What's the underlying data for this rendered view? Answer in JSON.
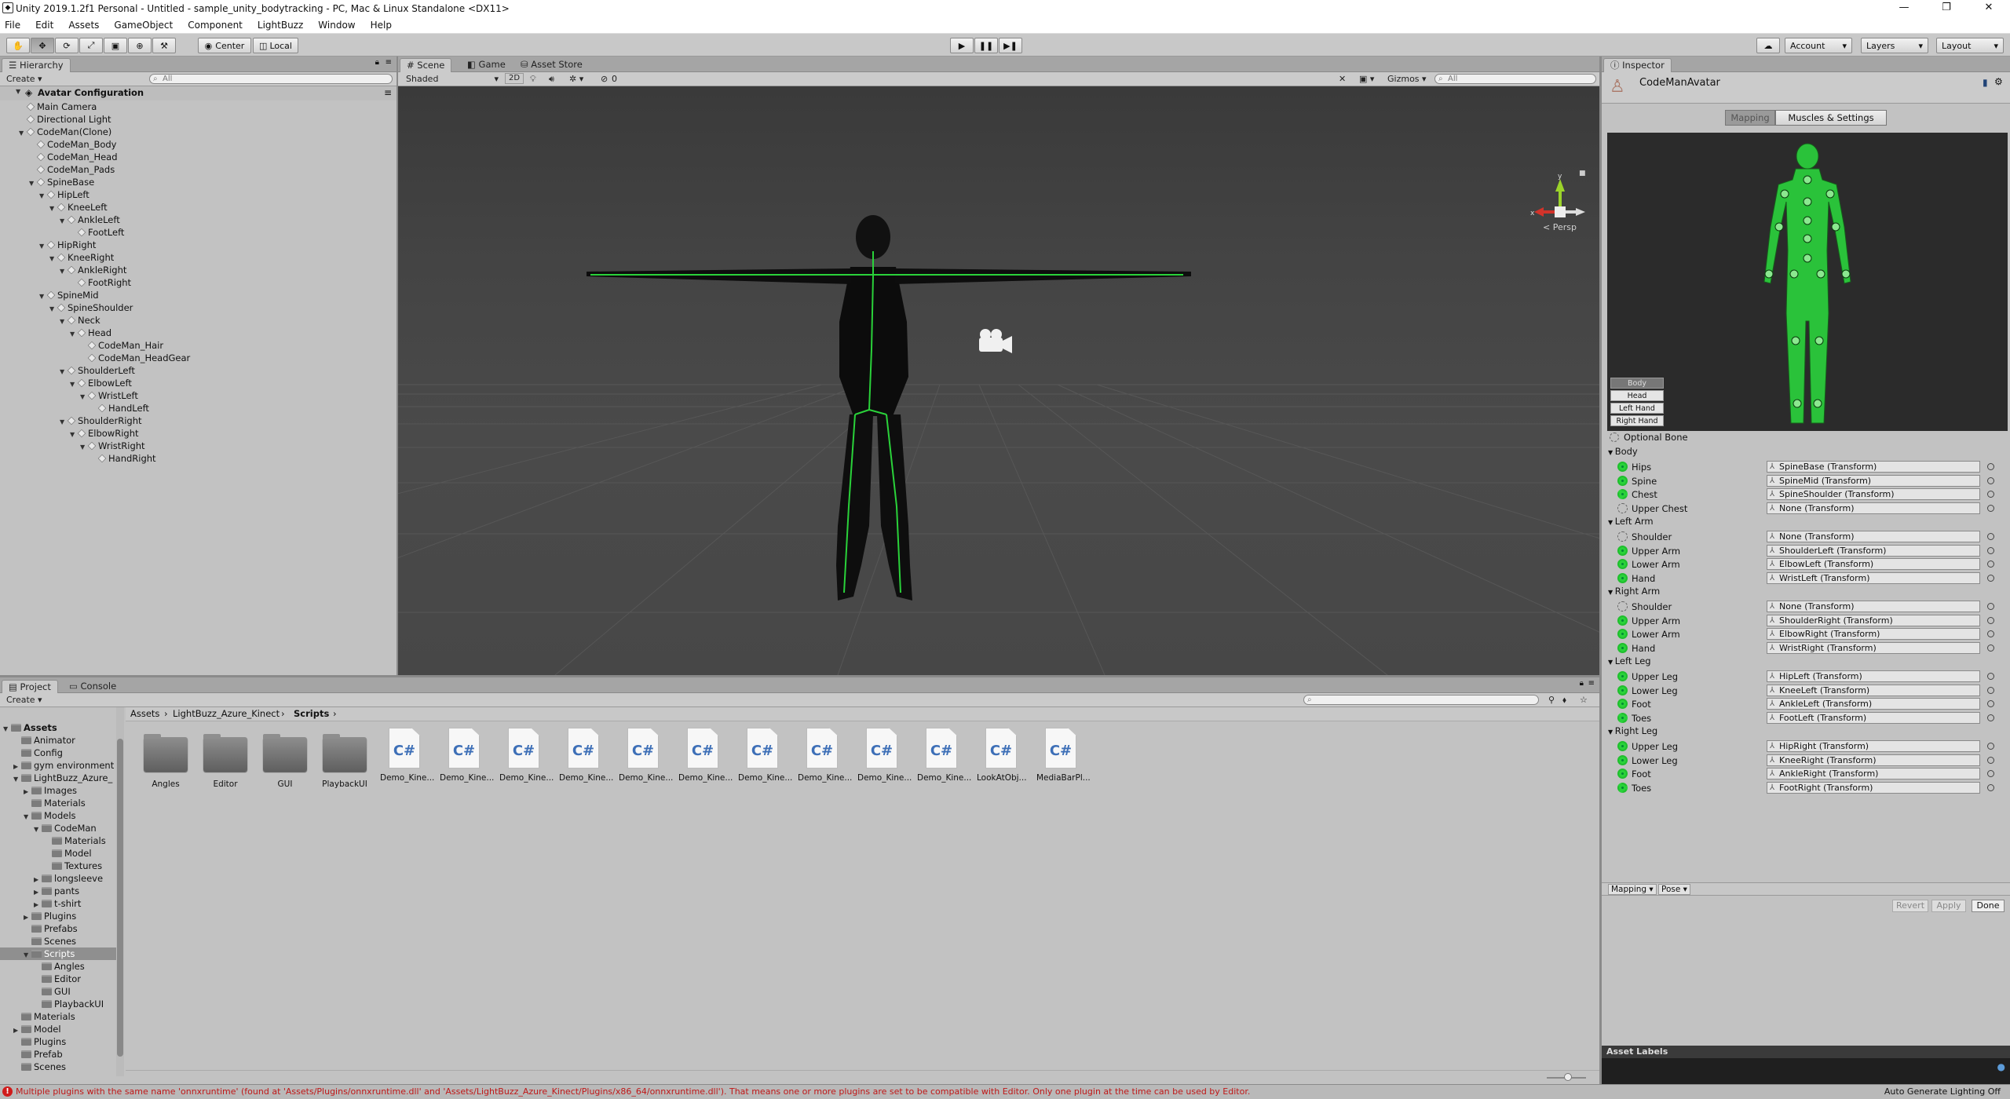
{
  "window": {
    "title": "Unity 2019.1.2f1 Personal - Untitled - sample_unity_bodytracking - PC, Mac & Linux Standalone <DX11>"
  },
  "menu": [
    "File",
    "Edit",
    "Assets",
    "GameObject",
    "Component",
    "LightBuzz",
    "Window",
    "Help"
  ],
  "toolbar": {
    "pivot": "Center",
    "space": "Local",
    "account": "Account",
    "layers": "Layers",
    "layout": "Layout"
  },
  "hierarchy": {
    "tab": "Hierarchy",
    "create": "Create",
    "search_placeholder": "All",
    "root": "Avatar Configuration",
    "items": [
      {
        "label": "Main Camera",
        "depth": 1,
        "arrow": ""
      },
      {
        "label": "Directional Light",
        "depth": 1,
        "arrow": ""
      },
      {
        "label": "CodeMan(Clone)",
        "depth": 1,
        "arrow": "▼"
      },
      {
        "label": "CodeMan_Body",
        "depth": 2,
        "arrow": ""
      },
      {
        "label": "CodeMan_Head",
        "depth": 2,
        "arrow": ""
      },
      {
        "label": "CodeMan_Pads",
        "depth": 2,
        "arrow": ""
      },
      {
        "label": "SpineBase",
        "depth": 2,
        "arrow": "▼"
      },
      {
        "label": "HipLeft",
        "depth": 3,
        "arrow": "▼"
      },
      {
        "label": "KneeLeft",
        "depth": 4,
        "arrow": "▼"
      },
      {
        "label": "AnkleLeft",
        "depth": 5,
        "arrow": "▼"
      },
      {
        "label": "FootLeft",
        "depth": 6,
        "arrow": ""
      },
      {
        "label": "HipRight",
        "depth": 3,
        "arrow": "▼"
      },
      {
        "label": "KneeRight",
        "depth": 4,
        "arrow": "▼"
      },
      {
        "label": "AnkleRight",
        "depth": 5,
        "arrow": "▼"
      },
      {
        "label": "FootRight",
        "depth": 6,
        "arrow": ""
      },
      {
        "label": "SpineMid",
        "depth": 3,
        "arrow": "▼"
      },
      {
        "label": "SpineShoulder",
        "depth": 4,
        "arrow": "▼"
      },
      {
        "label": "Neck",
        "depth": 5,
        "arrow": "▼"
      },
      {
        "label": "Head",
        "depth": 6,
        "arrow": "▼"
      },
      {
        "label": "CodeMan_Hair",
        "depth": 7,
        "arrow": ""
      },
      {
        "label": "CodeMan_HeadGear",
        "depth": 7,
        "arrow": ""
      },
      {
        "label": "ShoulderLeft",
        "depth": 5,
        "arrow": "▼"
      },
      {
        "label": "ElbowLeft",
        "depth": 6,
        "arrow": "▼"
      },
      {
        "label": "WristLeft",
        "depth": 7,
        "arrow": "▼"
      },
      {
        "label": "HandLeft",
        "depth": 8,
        "arrow": ""
      },
      {
        "label": "ShoulderRight",
        "depth": 5,
        "arrow": "▼"
      },
      {
        "label": "ElbowRight",
        "depth": 6,
        "arrow": "▼"
      },
      {
        "label": "WristRight",
        "depth": 7,
        "arrow": "▼"
      },
      {
        "label": "HandRight",
        "depth": 8,
        "arrow": ""
      }
    ]
  },
  "scene": {
    "tabs": [
      "Scene",
      "Game",
      "Asset Store"
    ],
    "shading": "Shaded",
    "mode2d": "2D",
    "fx_count": "0",
    "gizmos": "Gizmos",
    "search_placeholder": "All",
    "persp": "< Persp"
  },
  "project": {
    "tabs": [
      "Project",
      "Console"
    ],
    "create": "Create",
    "breadcrumb": [
      "Assets",
      "LightBuzz_Azure_Kinect",
      "Scripts"
    ],
    "tree": [
      {
        "label": "Assets",
        "depth": 0,
        "arrow": "▼",
        "bold": true
      },
      {
        "label": "Animator",
        "depth": 1,
        "arrow": ""
      },
      {
        "label": "Config",
        "depth": 1,
        "arrow": ""
      },
      {
        "label": "gym environment",
        "depth": 1,
        "arrow": "▶"
      },
      {
        "label": "LightBuzz_Azure_",
        "depth": 1,
        "arrow": "▼"
      },
      {
        "label": "Images",
        "depth": 2,
        "arrow": "▶"
      },
      {
        "label": "Materials",
        "depth": 2,
        "arrow": ""
      },
      {
        "label": "Models",
        "depth": 2,
        "arrow": "▼"
      },
      {
        "label": "CodeMan",
        "depth": 3,
        "arrow": "▼"
      },
      {
        "label": "Materials",
        "depth": 4,
        "arrow": ""
      },
      {
        "label": "Model",
        "depth": 4,
        "arrow": ""
      },
      {
        "label": "Textures",
        "depth": 4,
        "arrow": ""
      },
      {
        "label": "longsleeve",
        "depth": 3,
        "arrow": "▶"
      },
      {
        "label": "pants",
        "depth": 3,
        "arrow": "▶"
      },
      {
        "label": "t-shirt",
        "depth": 3,
        "arrow": "▶"
      },
      {
        "label": "Plugins",
        "depth": 2,
        "arrow": "▶"
      },
      {
        "label": "Prefabs",
        "depth": 2,
        "arrow": ""
      },
      {
        "label": "Scenes",
        "depth": 2,
        "arrow": ""
      },
      {
        "label": "Scripts",
        "depth": 2,
        "arrow": "▼",
        "selected": true
      },
      {
        "label": "Angles",
        "depth": 3,
        "arrow": ""
      },
      {
        "label": "Editor",
        "depth": 3,
        "arrow": ""
      },
      {
        "label": "GUI",
        "depth": 3,
        "arrow": ""
      },
      {
        "label": "PlaybackUI",
        "depth": 3,
        "arrow": ""
      },
      {
        "label": "Materials",
        "depth": 1,
        "arrow": ""
      },
      {
        "label": "Model",
        "depth": 1,
        "arrow": "▶"
      },
      {
        "label": "Plugins",
        "depth": 1,
        "arrow": ""
      },
      {
        "label": "Prefab",
        "depth": 1,
        "arrow": ""
      },
      {
        "label": "Scenes",
        "depth": 1,
        "arrow": ""
      }
    ],
    "assets": [
      {
        "label": "Angles",
        "kind": "folder"
      },
      {
        "label": "Editor",
        "kind": "folder"
      },
      {
        "label": "GUI",
        "kind": "folder"
      },
      {
        "label": "PlaybackUI",
        "kind": "folder"
      },
      {
        "label": "Demo_Kine...",
        "kind": "cs"
      },
      {
        "label": "Demo_Kine...",
        "kind": "cs"
      },
      {
        "label": "Demo_Kine...",
        "kind": "cs"
      },
      {
        "label": "Demo_Kine...",
        "kind": "cs"
      },
      {
        "label": "Demo_Kine...",
        "kind": "cs"
      },
      {
        "label": "Demo_Kine...",
        "kind": "cs"
      },
      {
        "label": "Demo_Kine...",
        "kind": "cs"
      },
      {
        "label": "Demo_Kine...",
        "kind": "cs"
      },
      {
        "label": "Demo_Kine...",
        "kind": "cs"
      },
      {
        "label": "Demo_Kine...",
        "kind": "cs"
      },
      {
        "label": "LookAtObj...",
        "kind": "cs"
      },
      {
        "label": "MediaBarPl...",
        "kind": "cs"
      }
    ],
    "cs_glyph": "C#"
  },
  "inspector": {
    "tab": "Inspector",
    "object_name": "CodeManAvatar",
    "mode_tabs": [
      "Mapping",
      "Muscles & Settings"
    ],
    "body_parts": [
      "Body",
      "Head",
      "Left Hand",
      "Right Hand"
    ],
    "optional_bone": "Optional Bone",
    "groups": [
      {
        "name": "Body",
        "bones": [
          {
            "label": "Hips",
            "value": "SpineBase (Transform)",
            "optional": false
          },
          {
            "label": "Spine",
            "value": "SpineMid (Transform)",
            "optional": false
          },
          {
            "label": "Chest",
            "value": "SpineShoulder (Transform)",
            "optional": true
          },
          {
            "label": "Upper Chest",
            "value": "None (Transform)",
            "optional": true
          }
        ]
      },
      {
        "name": "Left Arm",
        "bones": [
          {
            "label": "Shoulder",
            "value": "None (Transform)",
            "optional": true
          },
          {
            "label": "Upper Arm",
            "value": "ShoulderLeft (Transform)",
            "optional": false
          },
          {
            "label": "Lower Arm",
            "value": "ElbowLeft (Transform)",
            "optional": false
          },
          {
            "label": "Hand",
            "value": "WristLeft (Transform)",
            "optional": false
          }
        ]
      },
      {
        "name": "Right Arm",
        "bones": [
          {
            "label": "Shoulder",
            "value": "None (Transform)",
            "optional": true
          },
          {
            "label": "Upper Arm",
            "value": "ShoulderRight (Transform)",
            "optional": false
          },
          {
            "label": "Lower Arm",
            "value": "ElbowRight (Transform)",
            "optional": false
          },
          {
            "label": "Hand",
            "value": "WristRight (Transform)",
            "optional": false
          }
        ]
      },
      {
        "name": "Left Leg",
        "bones": [
          {
            "label": "Upper Leg",
            "value": "HipLeft (Transform)",
            "optional": false
          },
          {
            "label": "Lower Leg",
            "value": "KneeLeft (Transform)",
            "optional": false
          },
          {
            "label": "Foot",
            "value": "AnkleLeft (Transform)",
            "optional": false
          },
          {
            "label": "Toes",
            "value": "FootLeft (Transform)",
            "optional": true
          }
        ]
      },
      {
        "name": "Right Leg",
        "bones": [
          {
            "label": "Upper Leg",
            "value": "HipRight (Transform)",
            "optional": false
          },
          {
            "label": "Lower Leg",
            "value": "KneeRight (Transform)",
            "optional": false
          },
          {
            "label": "Foot",
            "value": "AnkleRight (Transform)",
            "optional": false
          },
          {
            "label": "Toes",
            "value": "FootRight (Transform)",
            "optional": true
          }
        ]
      }
    ],
    "footer_dropdowns": [
      "Mapping",
      "Pose"
    ],
    "buttons": {
      "revert": "Revert",
      "apply": "Apply",
      "done": "Done"
    },
    "asset_labels": "Asset Labels"
  },
  "status": {
    "message": "Multiple plugins with the same name 'onnxruntime' (found at 'Assets/Plugins/onnxruntime.dll' and 'Assets/LightBuzz_Azure_Kinect/Plugins/x86_64/onnxruntime.dll'). That means one or more plugins are set to be compatible with Editor. Only one plugin at the time can be used by Editor.",
    "right": "Auto Generate Lighting Off"
  },
  "colors": {
    "bone_green": "#2ad23a",
    "error_red": "#d01b1b",
    "selection": "#8f8f8f"
  }
}
